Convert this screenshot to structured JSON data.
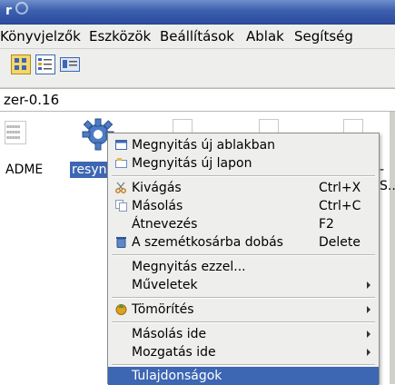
{
  "window": {
    "title_fragment": "r"
  },
  "menubar": {
    "items": [
      {
        "label": "Könyvjelzők"
      },
      {
        "label": "Eszközök"
      },
      {
        "label": "Beállítások"
      },
      {
        "label": "Ablak"
      },
      {
        "label": "Segítség"
      }
    ]
  },
  "location": {
    "path": "zer-0.16"
  },
  "files": [
    {
      "label": "ADME",
      "selected": false
    },
    {
      "label": "resyn",
      "selected": true
    },
    {
      "label": "-",
      "selected": false
    },
    {
      "label": "S..",
      "selected": false
    }
  ],
  "context_menu": {
    "items": [
      {
        "label": "Megnyitás új ablakban",
        "icon": "new-window-icon",
        "shortcut": "",
        "submenu": false
      },
      {
        "label": "Megnyitás új lapon",
        "icon": "new-tab-icon",
        "shortcut": "",
        "submenu": false
      },
      {
        "label": "Kivágás",
        "icon": "cut-icon",
        "shortcut": "Ctrl+X",
        "submenu": false
      },
      {
        "label": "Másolás",
        "icon": "copy-icon",
        "shortcut": "Ctrl+C",
        "submenu": false
      },
      {
        "label": "Átnevezés",
        "icon": "",
        "shortcut": "F2",
        "submenu": false
      },
      {
        "label": "A szemétkosárba dobás",
        "icon": "trash-icon",
        "shortcut": "Delete",
        "submenu": false
      },
      {
        "label": "Megnyitás ezzel...",
        "icon": "",
        "shortcut": "",
        "submenu": false
      },
      {
        "label": "Műveletek",
        "icon": "",
        "shortcut": "",
        "submenu": true
      },
      {
        "label": "Tömörítés",
        "icon": "compress-icon",
        "shortcut": "",
        "submenu": true
      },
      {
        "label": "Másolás ide",
        "icon": "",
        "shortcut": "",
        "submenu": true
      },
      {
        "label": "Mozgatás ide",
        "icon": "",
        "shortcut": "",
        "submenu": true
      },
      {
        "label": "Tulajdonságok",
        "icon": "",
        "shortcut": "",
        "submenu": false,
        "highlighted": true
      }
    ]
  },
  "colors": {
    "accent": "#3d66b3",
    "titlebar": "#3c5fae",
    "menu_bg": "#eeeeec"
  }
}
